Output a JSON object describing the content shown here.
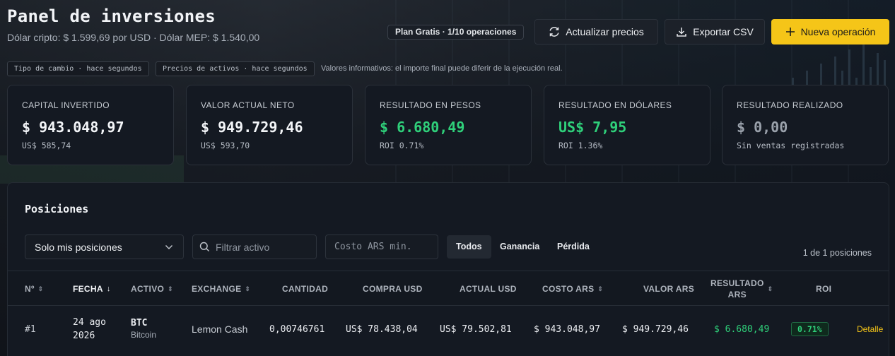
{
  "header": {
    "title": "Panel de inversiones",
    "subtitle": "Dólar cripto: $ 1.599,69 por USD · Dólar MEP: $ 1.540,00",
    "plan_badge": "Plan Gratis · 1/10 operaciones",
    "refresh_label": "Actualizar precios",
    "export_label": "Exportar CSV",
    "new_label": "Nueva operación"
  },
  "tags": {
    "exchange_rate": "Tipo de cambio · hace segundos",
    "asset_prices": "Precios de activos · hace segundos",
    "note": "Valores informativos: el importe final puede diferir de la ejecución real."
  },
  "cards": [
    {
      "label": "CAPITAL INVERTIDO",
      "value": "$ 943.048,97",
      "sub": "US$ 585,74"
    },
    {
      "label": "VALOR ACTUAL NETO",
      "value": "$ 949.729,46",
      "sub": "US$ 593,70"
    },
    {
      "label": "RESULTADO EN PESOS",
      "value": "$ 6.680,49",
      "sub": "ROI 0.71%"
    },
    {
      "label": "RESULTADO EN DÓLARES",
      "value": "US$ 7,95",
      "sub": "ROI 1.36%"
    },
    {
      "label": "RESULTADO REALIZADO",
      "value": "$ 0,00",
      "sub": "Sin ventas registradas"
    }
  ],
  "positions": {
    "title": "Posiciones",
    "select_value": "Solo mis posiciones",
    "filter_placeholder": "Filtrar activo",
    "cost_placeholder": "Costo ARS min.",
    "filters": [
      "Todos",
      "Ganancia",
      "Pérdida"
    ],
    "count": "1 de 1 posiciones",
    "columns": {
      "n": "Nº",
      "date": "FECHA",
      "asset": "ACTIVO",
      "exchange": "EXCHANGE",
      "qty": "CANTIDAD",
      "buy_usd": "COMPRA USD",
      "current_usd": "ACTUAL USD",
      "cost_ars": "COSTO ARS",
      "value_ars": "VALOR ARS",
      "result_ars_1": "RESULTADO",
      "result_ars_2": "ARS",
      "roi": "ROI"
    },
    "rows": [
      {
        "n": "#1",
        "date_1": "24 ago",
        "date_2": "2026",
        "asset_symbol": "BTC",
        "asset_name": "Bitcoin",
        "exchange": "Lemon Cash",
        "qty": "0,00746761",
        "buy_usd": "US$ 78.438,04",
        "current_usd": "US$ 79.502,81",
        "cost_ars": "$ 943.048,97",
        "value_ars": "$ 949.729,46",
        "result_ars": "$ 6.680,49",
        "roi": "0.71%",
        "action": "Detalle"
      }
    ]
  }
}
